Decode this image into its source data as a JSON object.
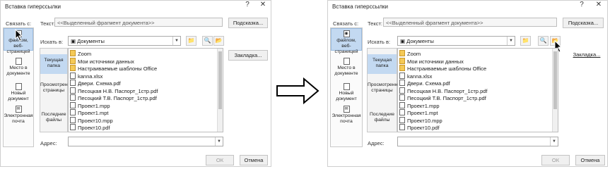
{
  "dialogs": [
    {
      "title": "Вставка гиперссылки",
      "help_glyph": "?",
      "close_glyph": "✕",
      "link_to_label": "Связать с:",
      "text_label": "Текст:",
      "text_value": "<<Выделенный фрагмент документа>>",
      "hint_button": "Подсказка...",
      "look_in_label": "Искать в:",
      "look_in_value": "Документы",
      "bookmark_button": "Закладка...",
      "sidebar": [
        {
          "label": "файлом, веб-страницей",
          "icon": "globe-icon",
          "selected": true
        },
        {
          "label": "Место в документе",
          "icon": "doc-place-icon",
          "selected": false
        },
        {
          "label": "Новый документ",
          "icon": "new-doc-icon",
          "selected": false
        },
        {
          "label": "Электронная почта",
          "icon": "email-icon",
          "selected": false
        }
      ],
      "middle": [
        {
          "label": "Текущая папка",
          "selected": true
        },
        {
          "label": "Просмотренные страницы",
          "selected": false
        },
        {
          "label": "Последние файлы",
          "selected": false
        }
      ],
      "files": [
        {
          "name": "Zoom",
          "type": "folder"
        },
        {
          "name": "Мои источники данных",
          "type": "folder"
        },
        {
          "name": "Настраиваемые шаблоны Office",
          "type": "folder"
        },
        {
          "name": "kanna.xlsx",
          "type": "file"
        },
        {
          "name": "Двери. Схема.pdf",
          "type": "file"
        },
        {
          "name": "Песоцкая Н.В. Паспорт_1стр.pdf",
          "type": "file"
        },
        {
          "name": "Песоцкий Т.В. Паспорт_1стр.pdf",
          "type": "file"
        },
        {
          "name": "Проект1.mpp",
          "type": "file"
        },
        {
          "name": "Проект1.mpt",
          "type": "file"
        },
        {
          "name": "Проект10.mpp",
          "type": "file"
        },
        {
          "name": "Проект10.pdf",
          "type": "file"
        }
      ],
      "address_label": "Адрес:",
      "ok_button": "ОК",
      "cancel_button": "Отмена"
    },
    {
      "title": "Вставка гиперссылки",
      "help_glyph": "?",
      "close_glyph": "✕",
      "link_to_label": "Связать с:",
      "text_label": "Текст:",
      "text_value": "<<Выделенный фрагмент документа>>",
      "hint_button": "Подсказка...",
      "look_in_label": "Искать в:",
      "look_in_value": "Документы",
      "bookmark_button": "Закладка...",
      "sidebar": [
        {
          "label": "файлом, веб-страницей",
          "icon": "globe-icon",
          "selected": true
        },
        {
          "label": "Место в документе",
          "icon": "doc-place-icon",
          "selected": false
        },
        {
          "label": "Новый документ",
          "icon": "new-doc-icon",
          "selected": false
        },
        {
          "label": "Электронная почта",
          "icon": "email-icon",
          "selected": false
        }
      ],
      "middle": [
        {
          "label": "Текущая папка",
          "selected": true
        },
        {
          "label": "Просмотренные страницы",
          "selected": false
        },
        {
          "label": "Последние файлы",
          "selected": false
        }
      ],
      "files": [
        {
          "name": "Zoom",
          "type": "folder"
        },
        {
          "name": "Мои источники данных",
          "type": "folder"
        },
        {
          "name": "Настраиваемые шаблоны Office",
          "type": "folder"
        },
        {
          "name": "kanna.xlsx",
          "type": "file"
        },
        {
          "name": "Двери. Схема.pdf",
          "type": "file"
        },
        {
          "name": "Песоцкая Н.В. Паспорт_1стр.pdf",
          "type": "file"
        },
        {
          "name": "Песоцкий Т.В. Паспорт_1стр.pdf",
          "type": "file"
        },
        {
          "name": "Проект1.mpp",
          "type": "file"
        },
        {
          "name": "Проект1.mpt",
          "type": "file"
        },
        {
          "name": "Проект10.mpp",
          "type": "file"
        },
        {
          "name": "Проект10.pdf",
          "type": "file"
        }
      ],
      "address_label": "Адрес:",
      "ok_button": "ОК",
      "cancel_button": "Отмена"
    }
  ],
  "colors": {
    "selection": "#c3d9f1",
    "folder": "#f4c956"
  }
}
